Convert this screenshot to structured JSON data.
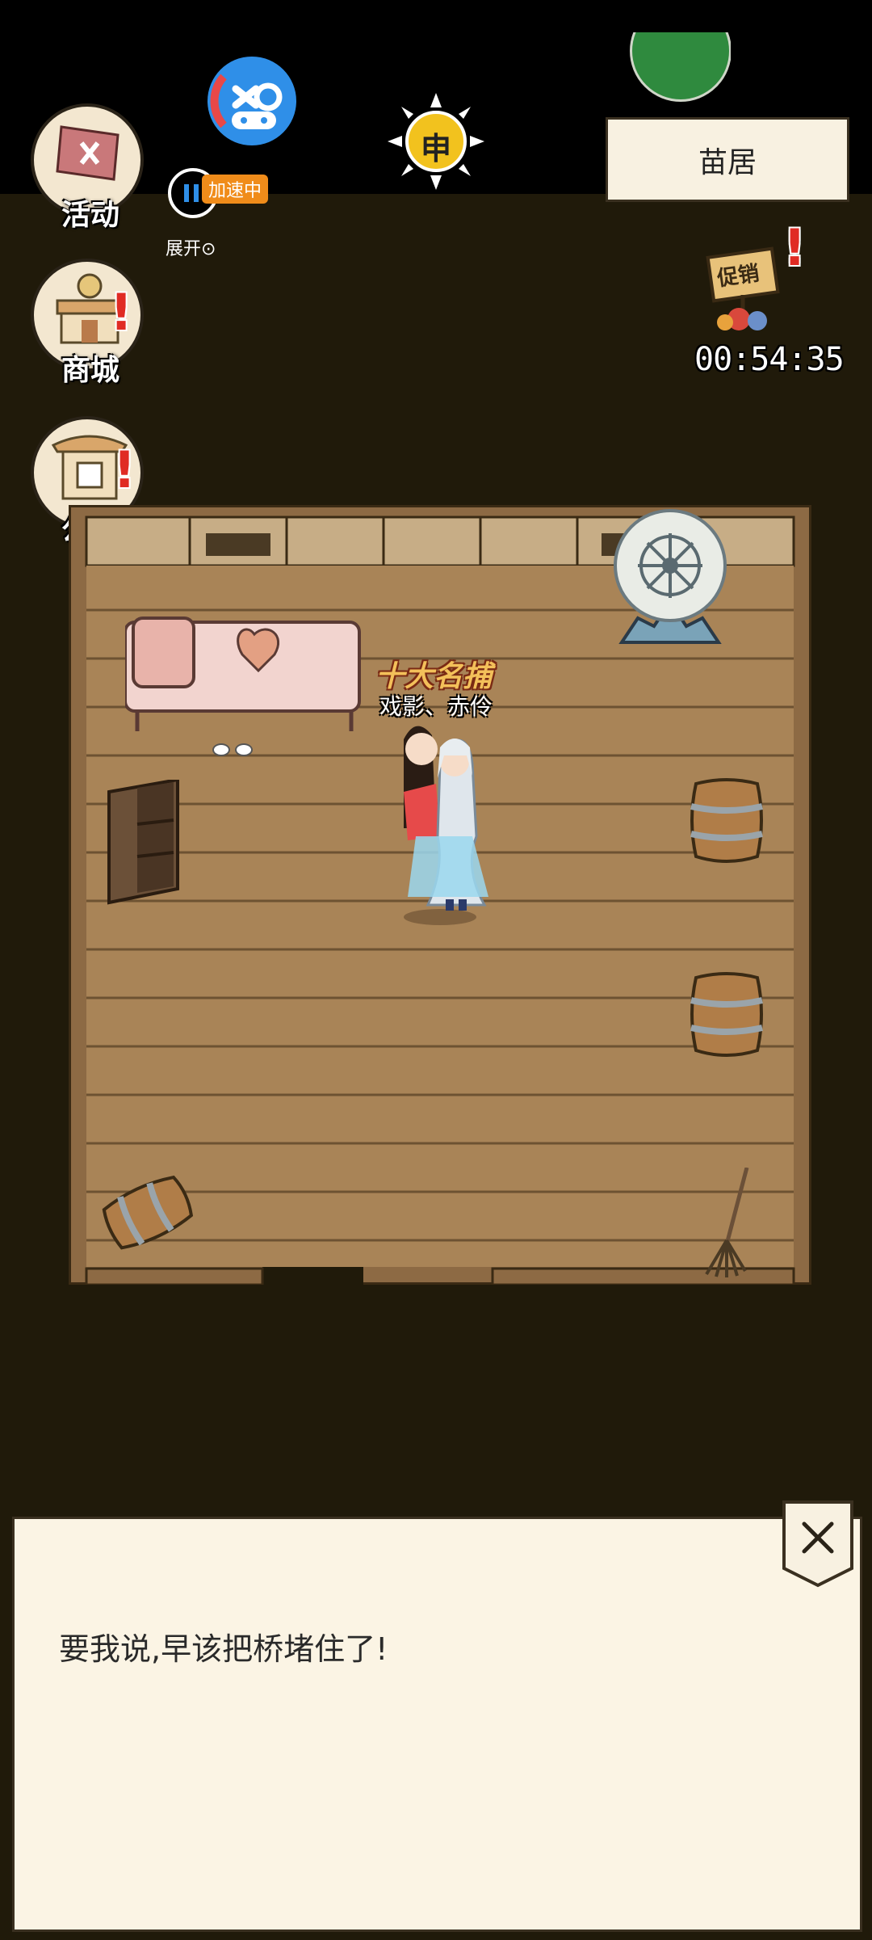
{
  "hud": {
    "activities_label": "活动",
    "shop_label": "商城",
    "notice_label": "公告",
    "alert_mark": "!",
    "accel_badge": "加速中",
    "expand_label": "展开⊙",
    "sun_char": "申",
    "location": "苗居",
    "promo_sign": "促销",
    "timer": "00:54:35"
  },
  "character": {
    "title": "十大名捕",
    "names": "戏影、赤伶"
  },
  "dialog": {
    "text": "要我说,早该把桥堵住了!"
  },
  "colors": {
    "background": "#201a0a",
    "floor": "#a98457",
    "dialog_bg": "#fbf4e4",
    "alert": "#e02b24",
    "accel": "#f08c1a"
  }
}
